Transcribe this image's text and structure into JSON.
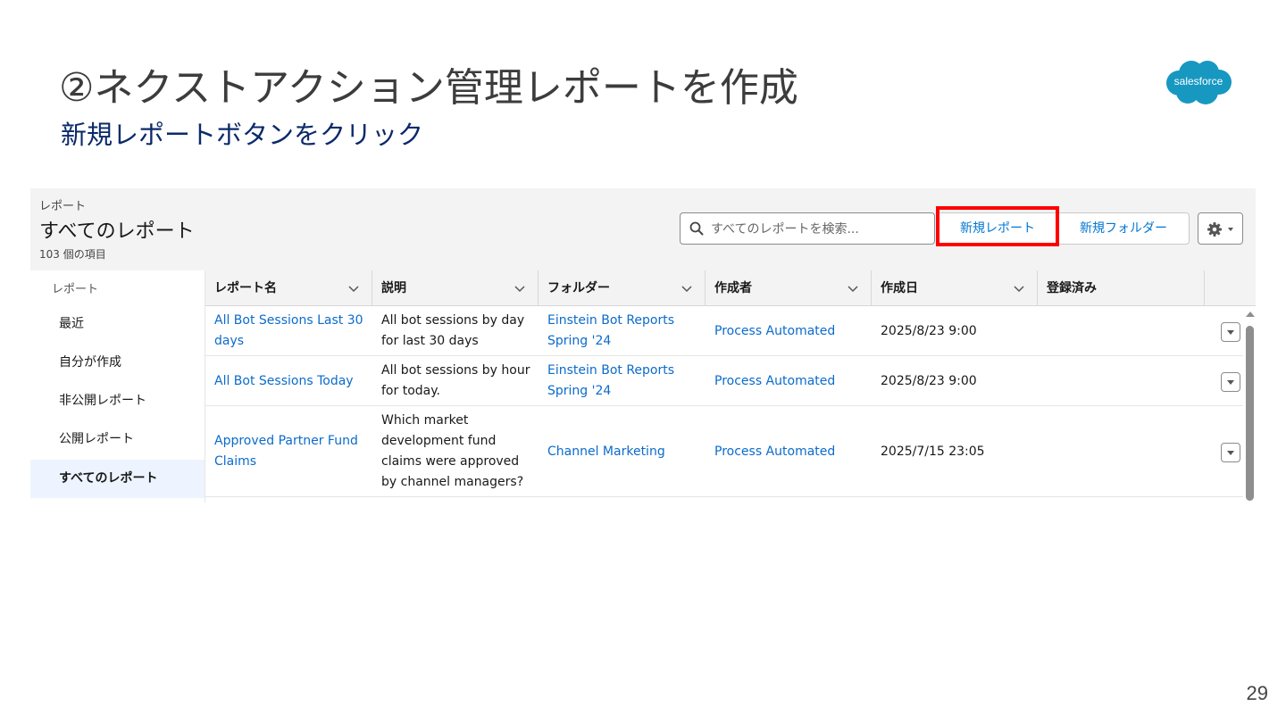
{
  "slide": {
    "title": "②ネクストアクション管理レポートを作成",
    "subtitle": "新規レポートボタンをクリック",
    "logo_text": "salesforce",
    "page_number": "29"
  },
  "header": {
    "breadcrumb": "レポート",
    "title": "すべてのレポート",
    "item_count": "103 個の項目",
    "search_placeholder": "すべてのレポートを検索...",
    "new_report_label": "新規レポート",
    "new_folder_label": "新規フォルダー"
  },
  "sidebar": {
    "section_label": "レポート",
    "items": [
      {
        "label": "最近"
      },
      {
        "label": "自分が作成"
      },
      {
        "label": "非公開レポート"
      },
      {
        "label": "公開レポート"
      },
      {
        "label": "すべてのレポート"
      }
    ]
  },
  "table": {
    "columns": [
      {
        "label": "レポート名"
      },
      {
        "label": "説明"
      },
      {
        "label": "フォルダー"
      },
      {
        "label": "作成者"
      },
      {
        "label": "作成日"
      },
      {
        "label": "登録済み"
      }
    ],
    "rows": [
      {
        "name": "All Bot Sessions Last 30 days",
        "description": "All bot sessions by day for last 30 days",
        "folder": "Einstein Bot Reports Spring '24",
        "created_by": "Process Automated",
        "created_date": "2025/8/23 9:00",
        "subscribed": ""
      },
      {
        "name": "All Bot Sessions Today",
        "description": "All bot sessions by hour for today.",
        "folder": "Einstein Bot Reports Spring '24",
        "created_by": "Process Automated",
        "created_date": "2025/8/23 9:00",
        "subscribed": ""
      },
      {
        "name": "Approved Partner Fund Claims",
        "description": "Which market development fund claims were approved by channel managers?",
        "folder": "Channel Marketing",
        "created_by": "Process Automated",
        "created_date": "2025/7/15 23:05",
        "subscribed": ""
      }
    ]
  },
  "colors": {
    "link": "#0b6bcb",
    "highlight": "#ff0000",
    "header_bg": "#f3f3f3",
    "logo": "#1798c1"
  }
}
